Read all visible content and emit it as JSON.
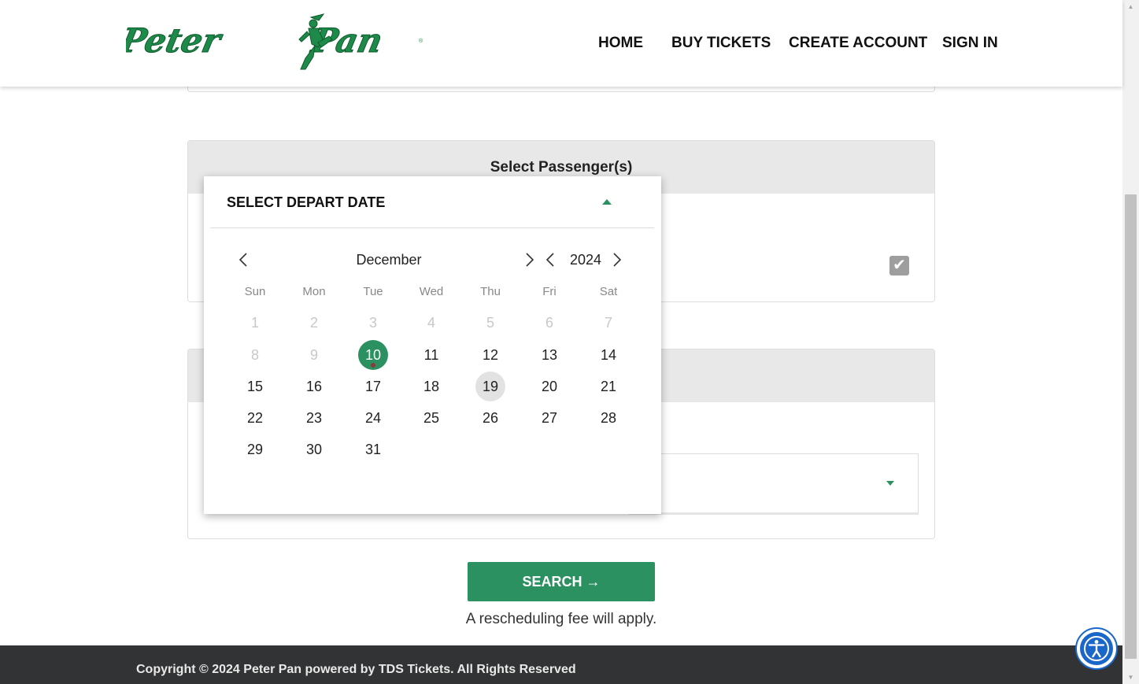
{
  "header": {
    "logo_text": "Peter Pan",
    "nav": [
      {
        "label": "HOME"
      },
      {
        "label": "BUY TICKETS"
      },
      {
        "label": "CREATE ACCOUNT"
      },
      {
        "label": "SIGN IN"
      }
    ]
  },
  "passengers_card": {
    "title": "Select Passenger(s)",
    "checked": true
  },
  "datepicker": {
    "title": "SELECT DEPART DATE",
    "month": "December",
    "year": "2024",
    "weekdays": [
      "Sun",
      "Mon",
      "Tue",
      "Wed",
      "Thu",
      "Fri",
      "Sat"
    ],
    "weeks": [
      [
        "1",
        "2",
        "3",
        "4",
        "5",
        "6",
        "7"
      ],
      [
        "8",
        "9",
        "10",
        "11",
        "12",
        "13",
        "14"
      ],
      [
        "15",
        "16",
        "17",
        "18",
        "19",
        "20",
        "21"
      ],
      [
        "22",
        "23",
        "24",
        "25",
        "26",
        "27",
        "28"
      ],
      [
        "29",
        "30",
        "31",
        "",
        "",
        "",
        ""
      ]
    ],
    "disabled_days": [
      "1",
      "2",
      "3",
      "4",
      "5",
      "6",
      "7",
      "8",
      "9"
    ],
    "selected_day": "10",
    "hovered_day": "19"
  },
  "search": {
    "label": "SEARCH →",
    "note": "A rescheduling fee will apply."
  },
  "footer": {
    "text": "Copyright © 2024 Peter Pan powered by TDS Tickets. All Rights Reserved"
  },
  "colors": {
    "brand_green": "#2b9160",
    "footer_bg": "#323334",
    "accessibility_blue": "#1b66c9"
  },
  "icons": [
    "chevron-left-icon",
    "chevron-right-icon",
    "caret-up-icon",
    "caret-down-icon",
    "checkmark-icon",
    "accessibility-icon"
  ]
}
